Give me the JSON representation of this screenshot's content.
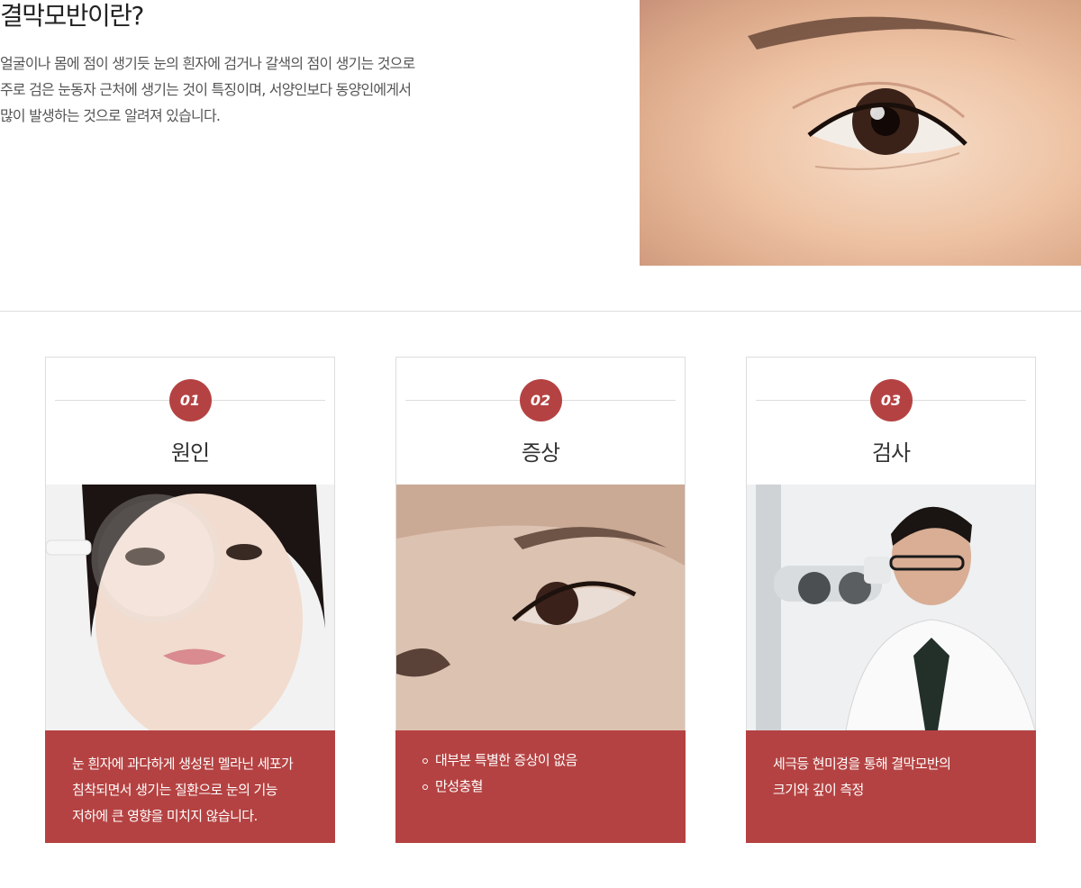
{
  "intro": {
    "title": "결막모반이란?",
    "lines": [
      "얼굴이나 몸에 점이 생기듯 눈의 흰자에 검거나 갈색의 점이 생기는 것으로",
      "주로 검은 눈동자 근처에 생기는 것이 특징이며, 서양인보다 동양인에게서",
      "많이 발생하는 것으로 알려져 있습니다."
    ]
  },
  "cards": [
    {
      "number": "01",
      "title": "원인",
      "lines": [
        "눈 흰자에 과다하게 생성된 멜라닌 세포가",
        "침착되면서 생기는 질환으로 눈의 기능",
        "저하에 큰 영향을 미치지 않습니다."
      ]
    },
    {
      "number": "02",
      "title": "증상",
      "bullets": [
        "대부분 특별한 증상이 없음",
        "만성충혈"
      ]
    },
    {
      "number": "03",
      "title": "검사",
      "lines": [
        "세극등 현미경을 통해 결막모반의",
        "크기와 깊이 측정"
      ]
    }
  ],
  "colors": {
    "accent": "#b54242",
    "border": "#dddddd",
    "text": "#333333"
  }
}
